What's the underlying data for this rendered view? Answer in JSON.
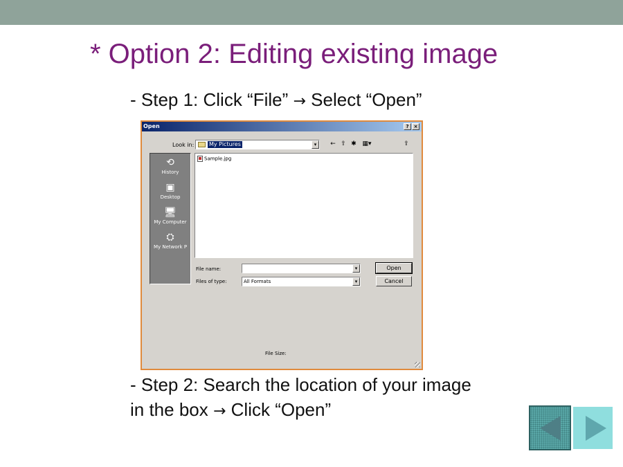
{
  "slide": {
    "title": "* Option 2: Editing existing image",
    "step1_prefix": "- Step 1: Click “File” ",
    "step1_suffix": " Select “Open”",
    "step2_line1": "- Step 2: Search the location of your image",
    "step2_line2_prefix": "in the box ",
    "step2_line2_suffix": " Click “Open”",
    "arrow_glyph": "→",
    "accent_color": "#7a1e7a"
  },
  "dialog": {
    "title": "Open",
    "help_glyph": "?",
    "close_glyph": "×",
    "look_in_label": "Look in:",
    "look_in_value": "My Pictures",
    "dropdown_glyph": "▾",
    "toolbar": {
      "back_glyph": "←",
      "up_glyph": "⇧",
      "new_folder_glyph": "✱",
      "views_glyph": "▦▾",
      "extra_glyph": "⇪"
    },
    "places": [
      {
        "label": "History",
        "icon": "history-icon",
        "glyph": "⟲"
      },
      {
        "label": "Desktop",
        "icon": "desktop-icon",
        "glyph": "▣"
      },
      {
        "label": "My Computer",
        "icon": "computer-icon",
        "glyph": "🖥"
      },
      {
        "label": "My Network P",
        "icon": "network-icon",
        "glyph": "⛭"
      }
    ],
    "files": [
      {
        "name": "Sample.jpg",
        "icon": "image-file-icon"
      }
    ],
    "file_name_label": "File name:",
    "file_name_value": "",
    "files_of_type_label": "Files of type:",
    "files_of_type_value": "All Formats",
    "open_button": "Open",
    "cancel_button": "Cancel",
    "file_size_label": "File Size:"
  },
  "nav": {
    "prev_icon": "previous-slide-icon",
    "next_icon": "next-slide-icon"
  }
}
